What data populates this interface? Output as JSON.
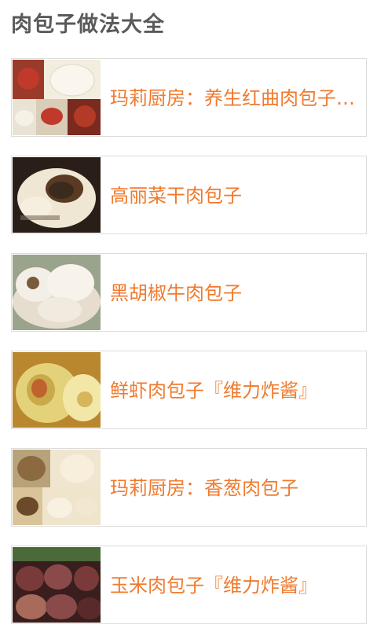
{
  "page": {
    "title": "肉包子做法大全"
  },
  "recipes": [
    {
      "title": "玛莉厨房：养生红曲肉包子《老...",
      "thumb_icon": "meat-bun-collage-image",
      "palette": [
        "#c0392b",
        "#f3ede0",
        "#7a2a1e",
        "#e9e3d5"
      ]
    },
    {
      "title": "高丽菜干肉包子",
      "thumb_icon": "meat-bun-cut-image",
      "palette": [
        "#3b2a1e",
        "#efe6d4",
        "#6b4a2e",
        "#2a1f18"
      ]
    },
    {
      "title": "黑胡椒牛肉包子",
      "thumb_icon": "steamed-buns-plate-image",
      "palette": [
        "#f4efe6",
        "#7a5a3c",
        "#e6ddcf",
        "#9aa38c"
      ]
    },
    {
      "title": "鲜虾肉包子『维力炸酱』",
      "thumb_icon": "shrimp-bun-image",
      "palette": [
        "#e4d27a",
        "#c9a94a",
        "#f3e7a8",
        "#b8872e"
      ]
    },
    {
      "title": "玛莉厨房：香葱肉包子",
      "thumb_icon": "scallion-bun-collage-image",
      "palette": [
        "#f0e6cf",
        "#b8a27a",
        "#e8dcc0",
        "#8a6a3e"
      ]
    },
    {
      "title": "玉米肉包子『维力炸酱』",
      "thumb_icon": "corn-bun-tray-image",
      "palette": [
        "#7a3a3a",
        "#5a2a2a",
        "#a86a5a",
        "#3a1e1e"
      ]
    }
  ]
}
